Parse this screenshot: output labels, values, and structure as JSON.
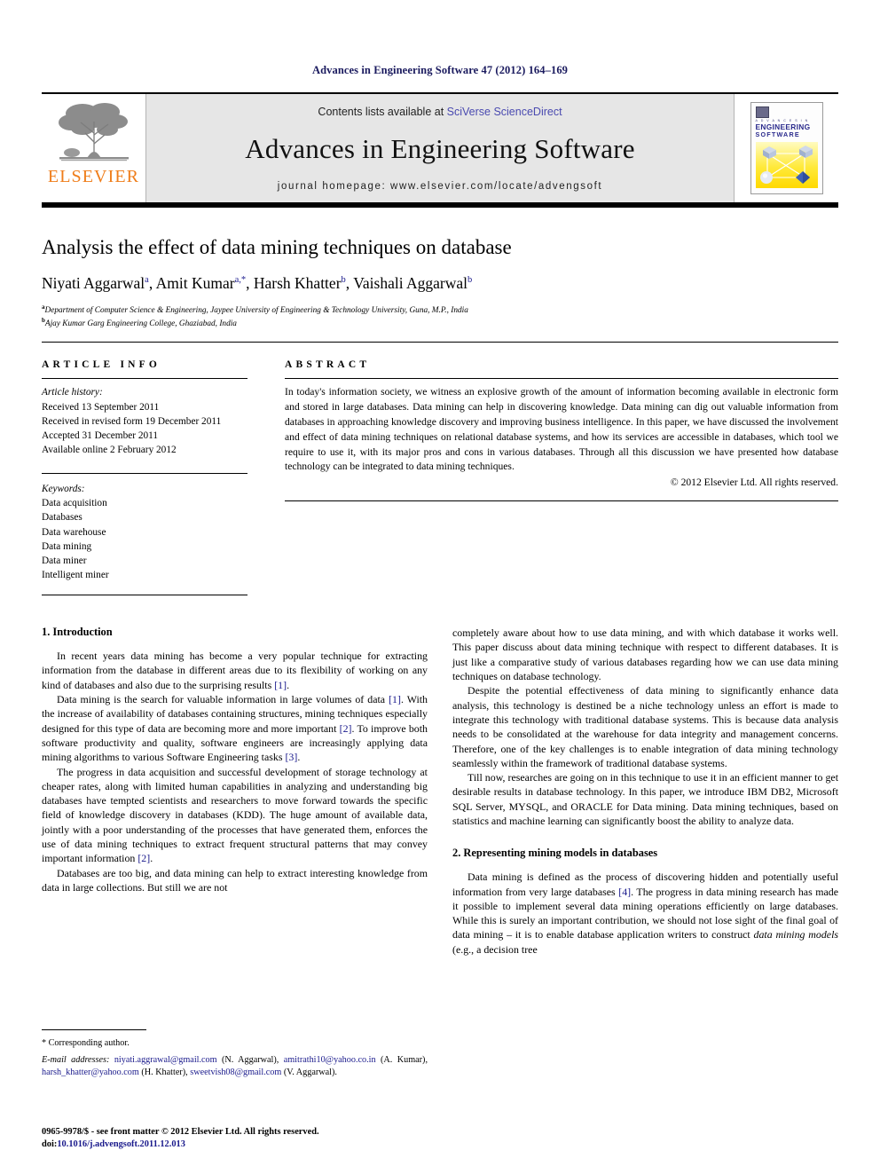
{
  "running_head": "Advances in Engineering Software 47 (2012) 164–169",
  "masthead": {
    "publisher_name": "ELSEVIER",
    "contents_prefix": "Contents lists available at ",
    "contents_link": "SciVerse ScienceDirect",
    "journal_name": "Advances in Engineering Software",
    "homepage_label": "journal homepage: www.elsevier.com/locate/advengsoft",
    "cover": {
      "line_small": "A D V A N C E S   I N",
      "line_big": "ENGINEERING",
      "line_mid": "SOFTWARE"
    }
  },
  "title": "Analysis the effect of data mining techniques on database",
  "authors": [
    {
      "name": "Niyati Aggarwal",
      "sup": "a"
    },
    {
      "name": "Amit Kumar",
      "sup": "a,*"
    },
    {
      "name": "Harsh Khatter",
      "sup": "b"
    },
    {
      "name": "Vaishali Aggarwal",
      "sup": "b"
    }
  ],
  "affiliations": [
    {
      "marker": "a",
      "text": "Department of Computer Science & Engineering, Jaypee University of Engineering & Technology University, Guna, M.P., India"
    },
    {
      "marker": "b",
      "text": "Ajay Kumar Garg Engineering College, Ghaziabad, India"
    }
  ],
  "article_info": {
    "label": "ARTICLE INFO",
    "history_head": "Article history:",
    "history": [
      "Received 13 September 2011",
      "Received in revised form 19 December 2011",
      "Accepted 31 December 2011",
      "Available online 2 February 2012"
    ],
    "keywords_head": "Keywords:",
    "keywords": [
      "Data acquisition",
      "Databases",
      "Data warehouse",
      "Data mining",
      "Data miner",
      "Intelligent miner"
    ]
  },
  "abstract": {
    "label": "ABSTRACT",
    "text": "In today's information society, we witness an explosive growth of the amount of information becoming available in electronic form and stored in large databases. Data mining can help in discovering knowledge. Data mining can dig out valuable information from databases in approaching knowledge discovery and improving business intelligence. In this paper, we have discussed the involvement and effect of data mining techniques on relational database systems, and how its services are accessible in databases, which tool we require to use it, with its major pros and cons in various databases. Through all this discussion we have presented how database technology can be integrated to data mining techniques.",
    "copyright": "© 2012 Elsevier Ltd. All rights reserved."
  },
  "body": {
    "left_column": {
      "section_heading": "1. Introduction",
      "paragraphs": [
        "In recent years data mining has become a very popular technique for extracting information from the database in different areas due to its flexibility of working on any kind of databases and also due to the surprising results [1].",
        "Data mining is the search for valuable information in large volumes of data [1]. With the increase of availability of databases containing structures, mining techniques especially designed for this type of data are becoming more and more important [2]. To improve both software productivity and quality, software engineers are increasingly applying data mining algorithms to various Software Engineering tasks [3].",
        "The progress in data acquisition and successful development of storage technology at cheaper rates, along with limited human capabilities in analyzing and understanding big databases have tempted scientists and researchers to move forward towards the specific field of knowledge discovery in databases (KDD). The huge amount of available data, jointly with a poor understanding of the processes that have generated them, enforces the use of data mining techniques to extract frequent structural patterns that may convey important information [2].",
        "Databases are too big, and data mining can help to extract interesting knowledge from data in large collections. But still we are not"
      ]
    },
    "right_column": {
      "section_heading": "2. Representing mining models in databases",
      "paragraphs": [
        "completely aware about how to use data mining, and with which database it works well. This paper discuss about data mining technique with respect to different databases. It is just like a comparative study of various databases regarding how we can use data mining techniques on database technology.",
        "Despite the potential effectiveness of data mining to significantly enhance data analysis, this technology is destined be a niche technology unless an effort is made to integrate this technology with traditional database systems. This is because data analysis needs to be consolidated at the warehouse for data integrity and management concerns. Therefore, one of the key challenges is to enable integration of data mining technology seamlessly within the framework of traditional database systems.",
        "Till now, researches are going on in this technique to use it in an efficient manner to get desirable results in database technology. In this paper, we introduce IBM DB2, Microsoft SQL Server, MYSQL, and ORACLE for Data mining. Data mining techniques, based on statistics and machine learning can significantly boost the ability to analyze data.",
        "Data mining is defined as the process of discovering hidden and potentially useful information from very large databases [4]. The progress in data mining research has made it possible to implement several data mining operations efficiently on large databases. While this is surely an important contribution, we should not lose sight of the final goal of data mining – it is to enable database application writers to construct data mining models (e.g., a decision tree"
      ]
    }
  },
  "footnote": {
    "corresponding": "* Corresponding author.",
    "email_label": "E-mail addresses:",
    "emails": [
      {
        "address": "niyati.aggrawal@gmail.com",
        "owner": "(N. Aggarwal)"
      },
      {
        "address": "amitrathi10@yahoo.co.in",
        "owner": "(A. Kumar)"
      },
      {
        "address": "harsh_khatter@yahoo.com",
        "owner": "(H. Khatter)"
      },
      {
        "address": "sweetvish08@gmail.com",
        "owner": "(V. Aggarwal)"
      }
    ]
  },
  "page_footer": {
    "front_matter": "0965-9978/$ - see front matter © 2012 Elsevier Ltd. All rights reserved.",
    "doi_label": "doi:",
    "doi": "10.1016/j.advengsoft.2011.12.013"
  },
  "colors": {
    "running_head": "#1a1a5e",
    "link": "#4a4ab0",
    "reference": "#1a1a8c",
    "elsevier_orange": "#ef7d1a",
    "masthead_band": "#e6e6e6"
  }
}
